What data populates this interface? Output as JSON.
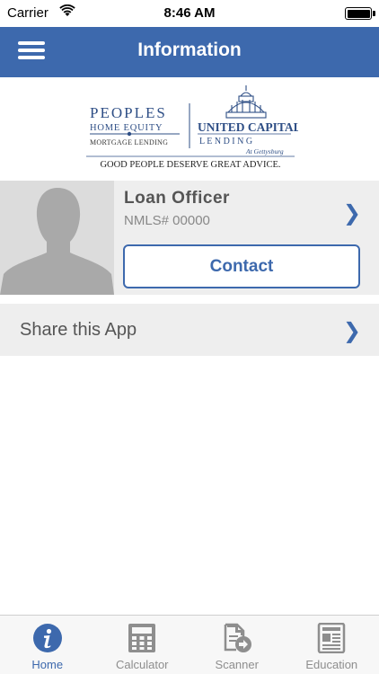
{
  "status_bar": {
    "carrier": "Carrier",
    "time": "8:46 AM"
  },
  "nav": {
    "title": "Information"
  },
  "logo": {
    "peoples": "PEOPLES",
    "home_equity": "HOME EQUITY",
    "mortgage_lending": "MORTGAGE LENDING",
    "united_capital": "UNITED CAPITAL",
    "lending": "L E N D I N G",
    "gettysburg": "At Gettysburg",
    "tagline": "GOOD PEOPLE DESERVE GREAT ADVICE."
  },
  "officer": {
    "name": "Loan  Officer",
    "nmls": "NMLS# 00000",
    "contact_label": "Contact"
  },
  "share": {
    "label": "Share this App"
  },
  "tabs": [
    {
      "label": "Home",
      "icon": "info-icon",
      "active": true
    },
    {
      "label": "Calculator",
      "icon": "calculator-icon",
      "active": false
    },
    {
      "label": "Scanner",
      "icon": "scanner-icon",
      "active": false
    },
    {
      "label": "Education",
      "icon": "newspaper-icon",
      "active": false
    }
  ],
  "colors": {
    "brand_blue": "#3d69ad",
    "card_gray": "#eeeeee",
    "tab_inactive": "#8e8e8e"
  }
}
